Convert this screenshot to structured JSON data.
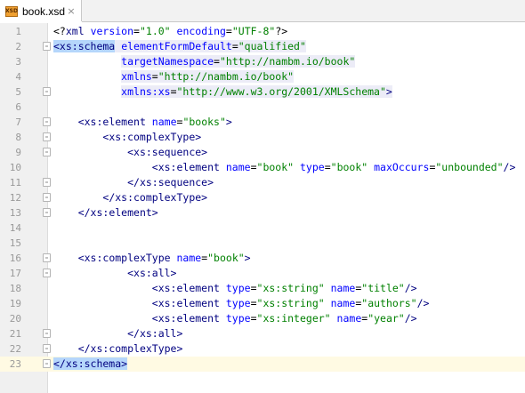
{
  "tab": {
    "icon_text": "XSD",
    "title": "book.xsd",
    "close_glyph": "×"
  },
  "editor": {
    "caret_line": 23,
    "lines": [
      {
        "n": "1",
        "parts": [
          {
            "t": "<?",
            "c": "pi"
          },
          {
            "t": "xml ",
            "c": "tag"
          },
          {
            "t": "version",
            "c": "attr"
          },
          {
            "t": "=",
            "c": "pi"
          },
          {
            "t": "\"1.0\"",
            "c": "val"
          },
          {
            "t": " ",
            "c": "pi"
          },
          {
            "t": "encoding",
            "c": "attr"
          },
          {
            "t": "=",
            "c": "pi"
          },
          {
            "t": "\"UTF-8\"",
            "c": "val"
          },
          {
            "t": "?>",
            "c": "pi"
          }
        ]
      },
      {
        "n": "2",
        "parts": [
          {
            "t": "<xs:schema",
            "c": "tag",
            "hl": "strong"
          },
          {
            "t": " ",
            "c": "pi",
            "hl": "soft"
          },
          {
            "t": "elementFormDefault",
            "c": "attr",
            "hl": "soft"
          },
          {
            "t": "=",
            "c": "pi",
            "hl": "soft"
          },
          {
            "t": "\"qualified\"",
            "c": "val",
            "hl": "soft"
          }
        ]
      },
      {
        "n": "3",
        "parts": [
          {
            "t": "           ",
            "c": "pi"
          },
          {
            "t": "targetNamespace",
            "c": "attr",
            "hl": "soft"
          },
          {
            "t": "=",
            "c": "pi",
            "hl": "soft"
          },
          {
            "t": "\"http://nambm.io/book\"",
            "c": "val",
            "hl": "soft"
          }
        ]
      },
      {
        "n": "4",
        "parts": [
          {
            "t": "           ",
            "c": "pi"
          },
          {
            "t": "xmlns",
            "c": "attr",
            "hl": "soft"
          },
          {
            "t": "=",
            "c": "pi",
            "hl": "soft"
          },
          {
            "t": "\"http://nambm.io/book\"",
            "c": "val",
            "hl": "soft"
          }
        ]
      },
      {
        "n": "5",
        "parts": [
          {
            "t": "           ",
            "c": "pi"
          },
          {
            "t": "xmlns:xs",
            "c": "attr",
            "hl": "soft"
          },
          {
            "t": "=",
            "c": "pi",
            "hl": "soft"
          },
          {
            "t": "\"http://www.w3.org/2001/XMLSchema\"",
            "c": "val",
            "hl": "soft"
          },
          {
            "t": ">",
            "c": "tag",
            "hl": "soft"
          }
        ]
      },
      {
        "n": "6",
        "parts": []
      },
      {
        "n": "7",
        "parts": [
          {
            "t": "    ",
            "c": "pi"
          },
          {
            "t": "<xs:element ",
            "c": "tag"
          },
          {
            "t": "name",
            "c": "attr"
          },
          {
            "t": "=",
            "c": "pi"
          },
          {
            "t": "\"books\"",
            "c": "val"
          },
          {
            "t": ">",
            "c": "tag"
          }
        ]
      },
      {
        "n": "8",
        "parts": [
          {
            "t": "        ",
            "c": "pi"
          },
          {
            "t": "<xs:complexType>",
            "c": "tag"
          }
        ]
      },
      {
        "n": "9",
        "parts": [
          {
            "t": "            ",
            "c": "pi"
          },
          {
            "t": "<xs:sequence>",
            "c": "tag"
          }
        ]
      },
      {
        "n": "10",
        "parts": [
          {
            "t": "                ",
            "c": "pi"
          },
          {
            "t": "<xs:element ",
            "c": "tag"
          },
          {
            "t": "name",
            "c": "attr"
          },
          {
            "t": "=",
            "c": "pi"
          },
          {
            "t": "\"book\"",
            "c": "val"
          },
          {
            "t": " ",
            "c": "pi"
          },
          {
            "t": "type",
            "c": "attr"
          },
          {
            "t": "=",
            "c": "pi"
          },
          {
            "t": "\"book\"",
            "c": "val"
          },
          {
            "t": " ",
            "c": "pi"
          },
          {
            "t": "maxOccurs",
            "c": "attr"
          },
          {
            "t": "=",
            "c": "pi"
          },
          {
            "t": "\"unbounded\"",
            "c": "val"
          },
          {
            "t": "/>",
            "c": "tag"
          }
        ]
      },
      {
        "n": "11",
        "parts": [
          {
            "t": "            ",
            "c": "pi"
          },
          {
            "t": "</xs:sequence>",
            "c": "tag"
          }
        ]
      },
      {
        "n": "12",
        "parts": [
          {
            "t": "        ",
            "c": "pi"
          },
          {
            "t": "</xs:complexType>",
            "c": "tag"
          }
        ]
      },
      {
        "n": "13",
        "parts": [
          {
            "t": "    ",
            "c": "pi"
          },
          {
            "t": "</xs:element>",
            "c": "tag"
          }
        ]
      },
      {
        "n": "14",
        "parts": []
      },
      {
        "n": "15",
        "parts": []
      },
      {
        "n": "16",
        "parts": [
          {
            "t": "    ",
            "c": "pi"
          },
          {
            "t": "<xs:complexType ",
            "c": "tag"
          },
          {
            "t": "name",
            "c": "attr"
          },
          {
            "t": "=",
            "c": "pi"
          },
          {
            "t": "\"book\"",
            "c": "val"
          },
          {
            "t": ">",
            "c": "tag"
          }
        ]
      },
      {
        "n": "17",
        "parts": [
          {
            "t": "            ",
            "c": "pi"
          },
          {
            "t": "<xs:all>",
            "c": "tag"
          }
        ]
      },
      {
        "n": "18",
        "parts": [
          {
            "t": "                ",
            "c": "pi"
          },
          {
            "t": "<xs:element ",
            "c": "tag"
          },
          {
            "t": "type",
            "c": "attr"
          },
          {
            "t": "=",
            "c": "pi"
          },
          {
            "t": "\"xs:string\"",
            "c": "val"
          },
          {
            "t": " ",
            "c": "pi"
          },
          {
            "t": "name",
            "c": "attr"
          },
          {
            "t": "=",
            "c": "pi"
          },
          {
            "t": "\"title\"",
            "c": "val"
          },
          {
            "t": "/>",
            "c": "tag"
          }
        ]
      },
      {
        "n": "19",
        "parts": [
          {
            "t": "                ",
            "c": "pi"
          },
          {
            "t": "<xs:element ",
            "c": "tag"
          },
          {
            "t": "type",
            "c": "attr"
          },
          {
            "t": "=",
            "c": "pi"
          },
          {
            "t": "\"xs:string\"",
            "c": "val"
          },
          {
            "t": " ",
            "c": "pi"
          },
          {
            "t": "name",
            "c": "attr"
          },
          {
            "t": "=",
            "c": "pi"
          },
          {
            "t": "\"authors\"",
            "c": "val"
          },
          {
            "t": "/>",
            "c": "tag"
          }
        ]
      },
      {
        "n": "20",
        "parts": [
          {
            "t": "                ",
            "c": "pi"
          },
          {
            "t": "<xs:element ",
            "c": "tag"
          },
          {
            "t": "type",
            "c": "attr"
          },
          {
            "t": "=",
            "c": "pi"
          },
          {
            "t": "\"xs:integer\"",
            "c": "val"
          },
          {
            "t": " ",
            "c": "pi"
          },
          {
            "t": "name",
            "c": "attr"
          },
          {
            "t": "=",
            "c": "pi"
          },
          {
            "t": "\"year\"",
            "c": "val"
          },
          {
            "t": "/>",
            "c": "tag"
          }
        ]
      },
      {
        "n": "21",
        "parts": [
          {
            "t": "            ",
            "c": "pi"
          },
          {
            "t": "</xs:all>",
            "c": "tag"
          }
        ]
      },
      {
        "n": "22",
        "parts": [
          {
            "t": "    ",
            "c": "pi"
          },
          {
            "t": "</xs:complexType>",
            "c": "tag"
          }
        ]
      },
      {
        "n": "23",
        "parts": [
          {
            "t": "</xs:schema>",
            "c": "tag",
            "hl": "strong"
          }
        ]
      }
    ],
    "fold_markers": {
      "2": "start",
      "5": "end",
      "7": "start",
      "8": "start",
      "9": "start",
      "11": "end",
      "12": "end",
      "13": "end",
      "16": "start",
      "17": "start",
      "21": "end",
      "22": "end",
      "23": "end"
    }
  },
  "colors": {
    "tag": "#000080",
    "attribute": "#0000ff",
    "value": "#008000",
    "selection": "#b5d6fb",
    "caret_line": "#fffae3"
  }
}
